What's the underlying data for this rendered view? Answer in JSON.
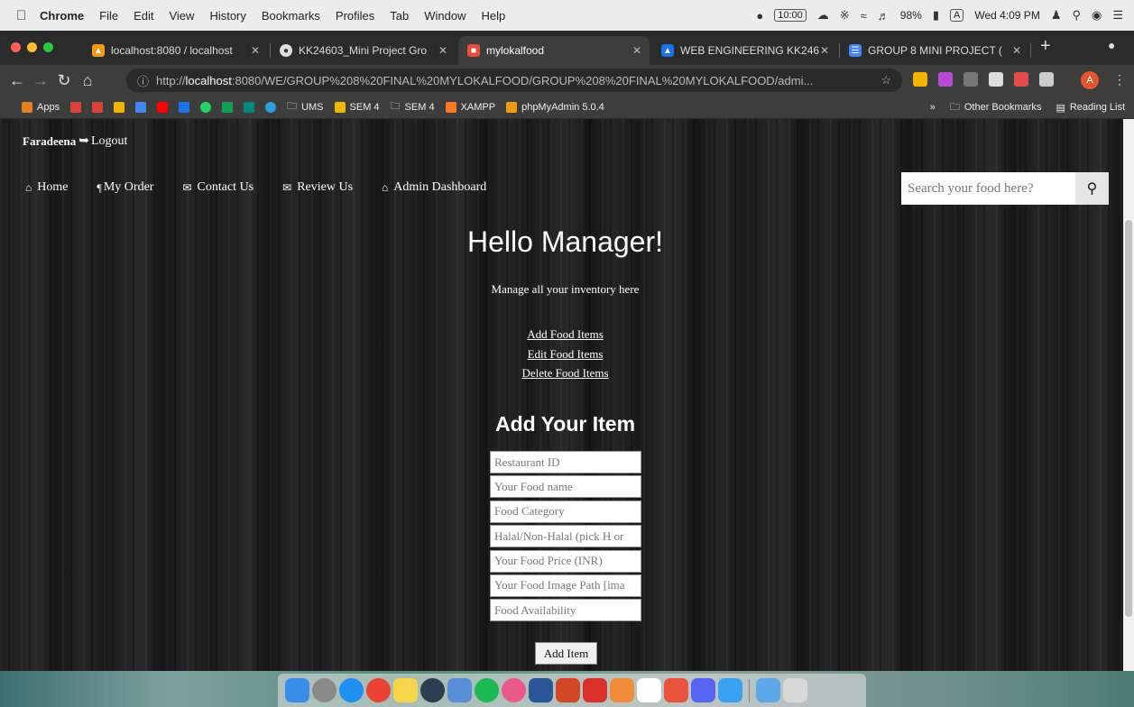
{
  "menubar": {
    "apple": "",
    "items": [
      "Chrome",
      "File",
      "Edit",
      "View",
      "History",
      "Bookmarks",
      "Profiles",
      "Tab",
      "Window",
      "Help"
    ],
    "clock_badge": "10:00",
    "battery": "98%",
    "datetime": "Wed 4:09 PM"
  },
  "tabs": [
    {
      "title": "localhost:8080 / localhost",
      "color": "#f39c12"
    },
    {
      "title": "KK24603_Mini Project Gro",
      "color": "#666666"
    },
    {
      "title": "mylokalfood",
      "color": "#e74c3c"
    },
    {
      "title": "WEB ENGINEERING KK246",
      "color": "#1a73e8"
    },
    {
      "title": "GROUP 8 MINI PROJECT (",
      "color": "#4285f4"
    }
  ],
  "toolbar": {
    "url_prefix": "http://",
    "url_host": "localhost",
    "url_rest": ":8080/WE/GROUP%208%20FINAL%20MYLOKALFOOD/GROUP%208%20FINAL%20MYLOKALFOOD/admi...",
    "profile_initial": "A"
  },
  "bookmarks": {
    "apps": "Apps",
    "items": [
      "UMS",
      "SEM 4",
      "SEM 4",
      "XAMPP",
      "phpMyAdmin 5.0.4"
    ],
    "chevron": "»",
    "other": "Other Bookmarks",
    "reading": "Reading List"
  },
  "page": {
    "username": "Faradeena",
    "logout": "Logout",
    "nav": [
      "Home",
      "My Order",
      "Contact Us",
      "Review Us",
      "Admin Dashboard"
    ],
    "search_placeholder": "Search your food here?",
    "hello": "Hello Manager!",
    "manage": "Manage all your inventory here",
    "links": [
      "Add Food Items",
      "Edit Food Items",
      "Delete Food Items"
    ],
    "add_title": "Add Your Item",
    "fields": [
      "Restaurant ID",
      "Your Food name",
      "Food Category",
      "Halal/Non-Halal (pick H or",
      "Your Food Price (INR)",
      "Your Food Image Path [ima",
      "Food Availability"
    ],
    "add_button": "Add Item"
  },
  "colors": {
    "accent_red": "#e74c3c",
    "page_bg": "#1e1e1e"
  }
}
